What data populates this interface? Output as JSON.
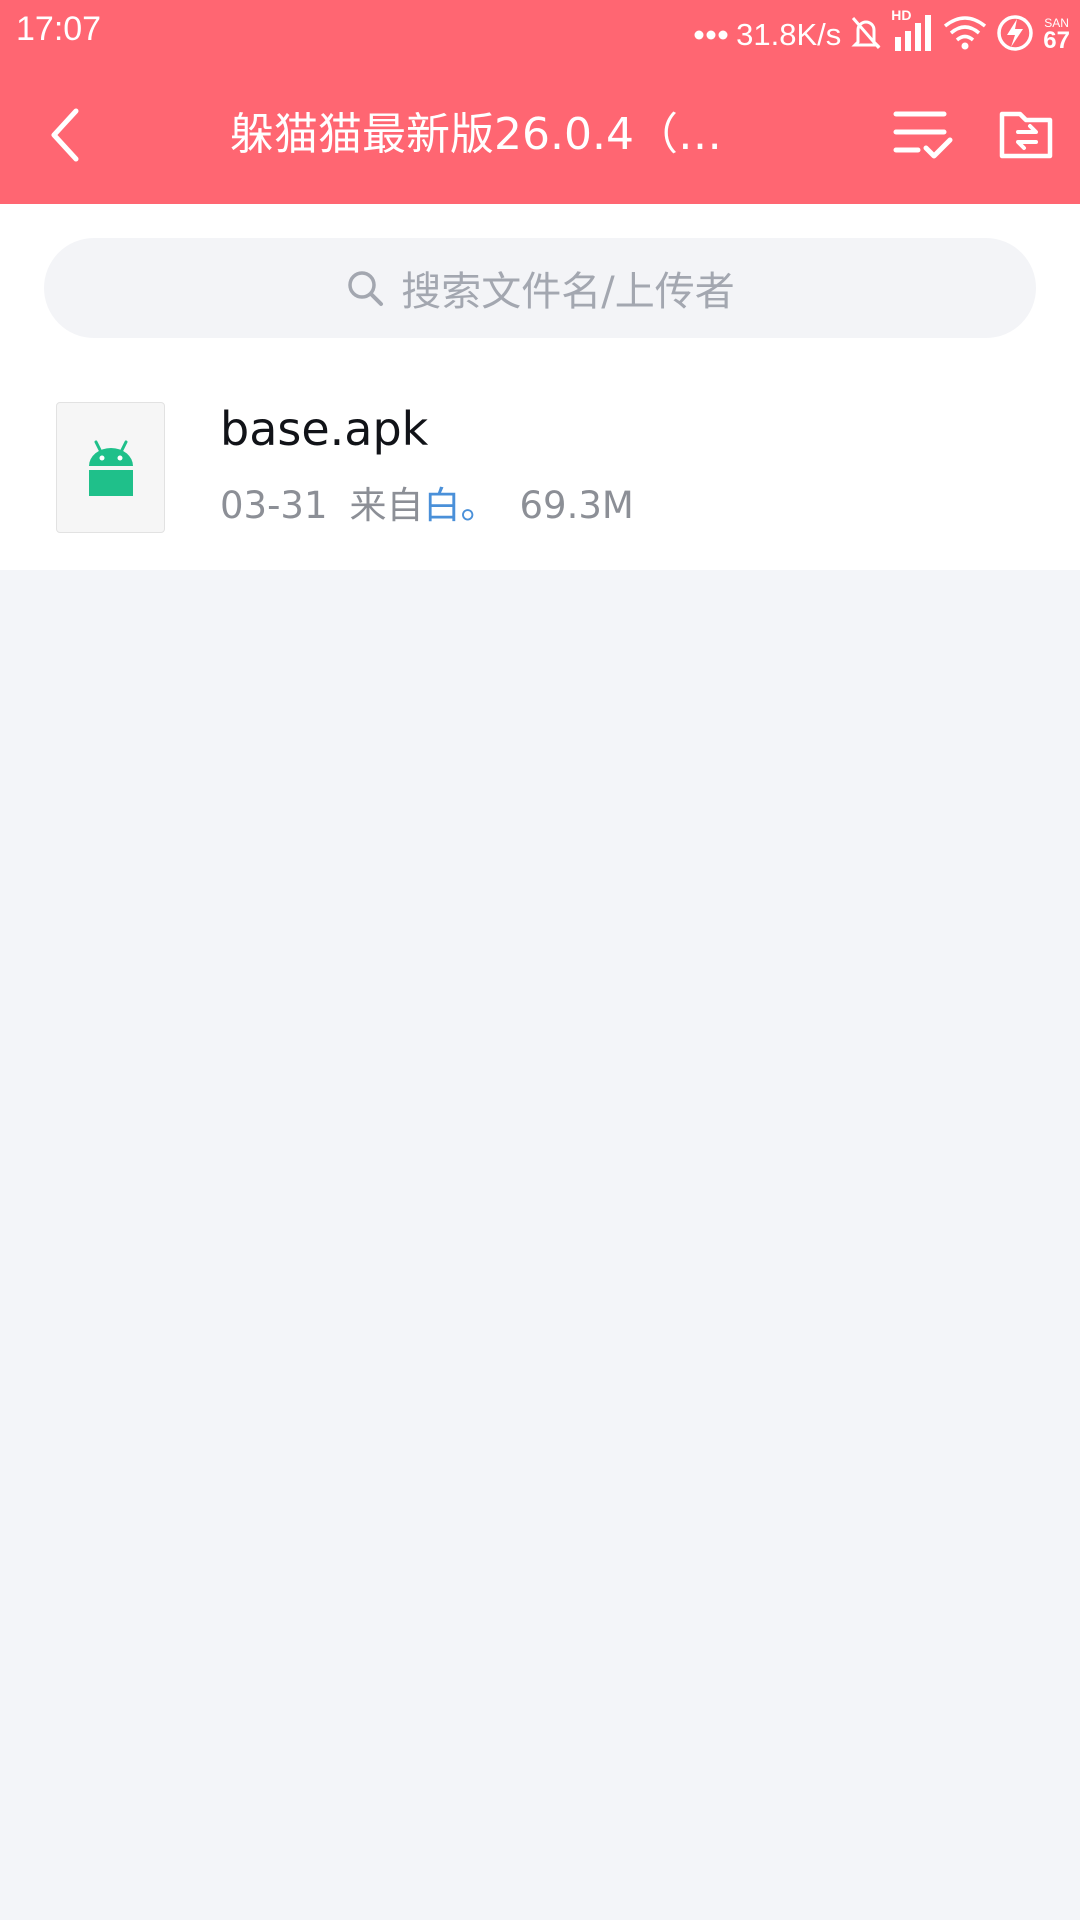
{
  "status_bar": {
    "time": "17:07",
    "network_speed": "31.8K/s",
    "signal_label": "HD",
    "battery_small": "SAN",
    "battery_level": "67",
    "icons": [
      "more-dots-icon",
      "bell-muted-icon",
      "signal-icon",
      "wifi-icon",
      "battery-charging-icon"
    ]
  },
  "header": {
    "title": "躲猫猫最新版26.0.4（…",
    "back_icon": "chevron-left-icon",
    "select_icon": "list-check-icon",
    "folder_icon": "folder-transfer-icon"
  },
  "colors": {
    "header_bg": "#ff6672",
    "uploader_link": "#4a90d9",
    "android_green": "#1fc08a"
  },
  "search": {
    "placeholder": "搜索文件名/上传者"
  },
  "files": [
    {
      "name": "base.apk",
      "date": "03-31",
      "from_label": "来自",
      "uploader": "白。",
      "size": "69.3M",
      "icon": "android-icon"
    }
  ]
}
